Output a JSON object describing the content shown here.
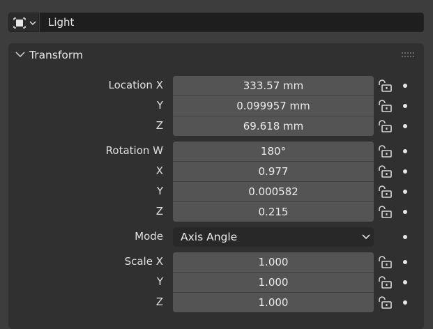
{
  "object": {
    "type_icon": "light-object-icon",
    "name": "Light"
  },
  "transform": {
    "title": "Transform",
    "location": [
      {
        "label": "Location X",
        "value": "333.57 mm"
      },
      {
        "label": "Y",
        "value": "0.099957 mm"
      },
      {
        "label": "Z",
        "value": "69.618 mm"
      }
    ],
    "rotation": [
      {
        "label": "Rotation W",
        "value": "180°"
      },
      {
        "label": "X",
        "value": "0.977"
      },
      {
        "label": "Y",
        "value": "0.000582"
      },
      {
        "label": "Z",
        "value": "0.215"
      }
    ],
    "mode": {
      "label": "Mode",
      "value": "Axis Angle"
    },
    "scale": [
      {
        "label": "Scale X",
        "value": "1.000"
      },
      {
        "label": "Y",
        "value": "1.000"
      },
      {
        "label": "Z",
        "value": "1.000"
      }
    ]
  },
  "colors": {
    "background": "#3d3d3d",
    "panel": "#303030",
    "field": "#545454",
    "dark_field": "#1e1e1e"
  }
}
